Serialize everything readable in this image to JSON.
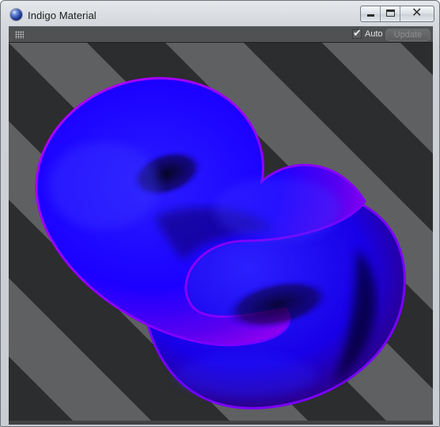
{
  "window": {
    "title": "Indigo Material",
    "icon": "indigo-sphere-icon"
  },
  "caption_buttons": {
    "minimize": "minimize-icon",
    "maximize": "maximize-icon",
    "close": "close-icon",
    "close_glyph": "✕"
  },
  "toolbar": {
    "grip_icon": "grip-icon",
    "auto": {
      "label": "Auto",
      "checked": true,
      "check_glyph": "✔"
    },
    "update_label": "Update",
    "update_enabled": false
  },
  "preview": {
    "subject": "torus-knot",
    "material_colors": {
      "core": "#1b00ff",
      "mid": "#6a00ff",
      "rim": "#b600ff"
    },
    "background_colors": {
      "dark_stripe": "#2b2d2e",
      "light_stripe": "#5e6062"
    }
  }
}
